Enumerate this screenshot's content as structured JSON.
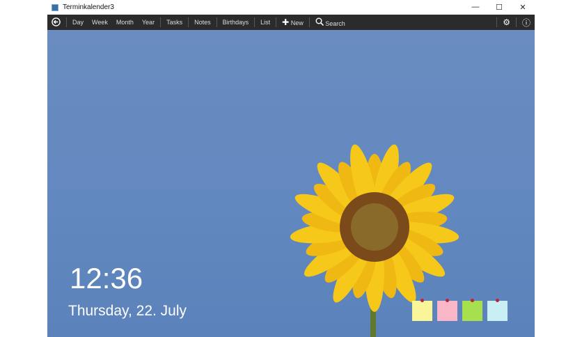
{
  "window": {
    "title": "Terminkalender3",
    "controls": [
      "—",
      "☐",
      "✕"
    ]
  },
  "toolbar": {
    "back": "⮌",
    "items": [
      "Day",
      "Week",
      "Month",
      "Year",
      "Tasks",
      "Notes",
      "Birthdays",
      "List"
    ],
    "new_label": "New",
    "search_label": "Search",
    "settings": "⚙",
    "info": "ⓘ"
  },
  "lockscreen": {
    "time": "12:36",
    "date": "Thursday, 22. July"
  },
  "notes": [
    {
      "color": "#fbf59a"
    },
    {
      "color": "#f9b6c6"
    },
    {
      "color": "#a7e04e"
    },
    {
      "color": "#c9eef3"
    }
  ]
}
